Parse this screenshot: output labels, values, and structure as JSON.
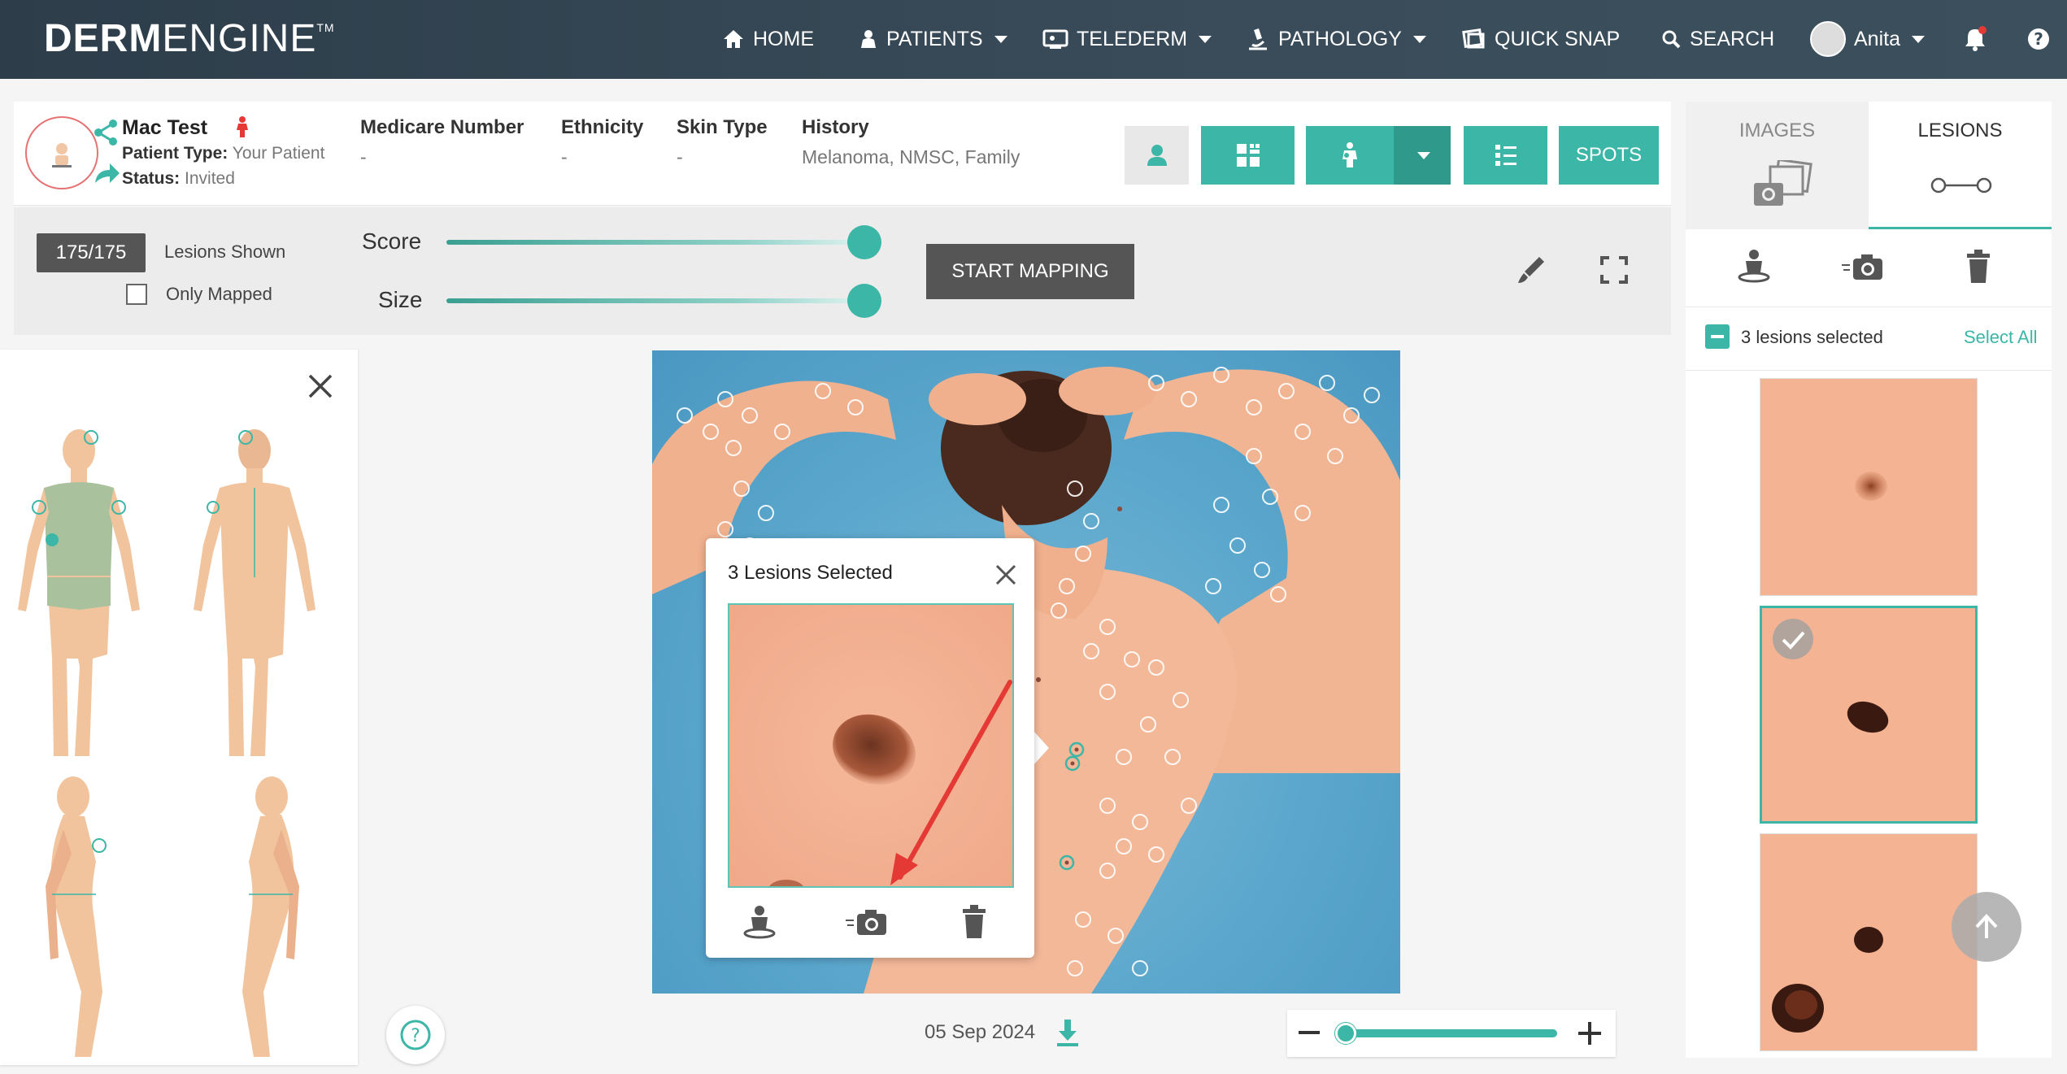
{
  "brand": {
    "logo_bold": "DERM",
    "logo_light": "ENGINE",
    "logo_tm": "TM"
  },
  "nav": {
    "home": "HOME",
    "patients": "PATIENTS",
    "telederm": "TELEDERM",
    "pathology": "PATHOLOGY",
    "quick_snap": "QUICK SNAP",
    "search": "SEARCH",
    "user": "Anita"
  },
  "patient": {
    "name": "Mac Test",
    "type_label": "Patient Type:",
    "type_value": "Your Patient",
    "status_label": "Status:",
    "status_value": "Invited",
    "columns": [
      {
        "label": "Medicare Number",
        "value": "-"
      },
      {
        "label": "Ethnicity",
        "value": "-"
      },
      {
        "label": "Skin Type",
        "value": "-"
      },
      {
        "label": "History",
        "value": "Melanoma, NMSC, Family"
      }
    ],
    "spots_label": "SPOTS"
  },
  "filters": {
    "count": "175/175",
    "lesions_shown": "Lesions Shown",
    "only_mapped": "Only Mapped",
    "score_label": "Score",
    "size_label": "Size",
    "score_fraction": 1.0,
    "size_fraction": 1.0,
    "start_mapping": "START MAPPING"
  },
  "popup": {
    "title": "3 Lesions Selected"
  },
  "image_footer": {
    "date": "05 Sep 2024",
    "zoom_fraction": 0.0
  },
  "right": {
    "tab_images": "IMAGES",
    "tab_lesions": "LESIONS",
    "selected_text": "3 lesions selected",
    "select_all": "Select All"
  },
  "colors": {
    "accent": "#3cb6a6",
    "nav_bg": "#2d3d4a",
    "sky": "#5aa6cc",
    "skin": "#f1b08e",
    "arrow": "#e53935"
  }
}
